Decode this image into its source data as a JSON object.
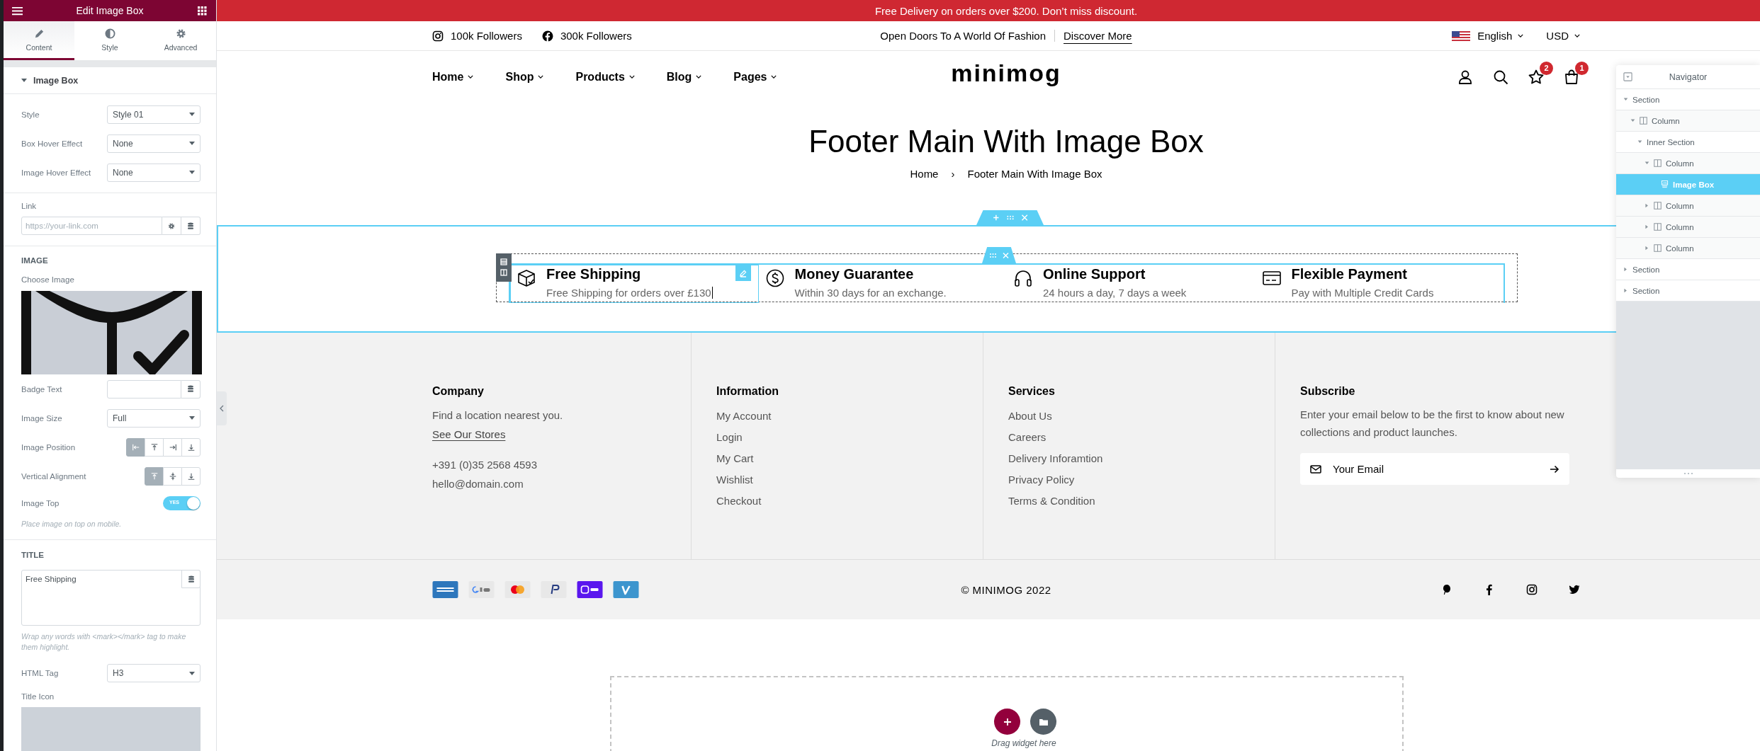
{
  "panel": {
    "title": "Edit Image Box",
    "tabs": [
      {
        "label": "Content",
        "kind": "pencil",
        "selected": true
      },
      {
        "label": "Style",
        "kind": "contrast",
        "selected": false
      },
      {
        "label": "Advanced",
        "kind": "gear",
        "selected": false
      }
    ],
    "section": {
      "title": "Image Box",
      "expanded": true
    },
    "effects": [
      {
        "label": "Style",
        "value": "Style 01"
      },
      {
        "label": "Box Hover Effect",
        "value": "None"
      },
      {
        "label": "Image Hover Effect",
        "value": "None"
      }
    ],
    "link": {
      "label": "Link",
      "placeholder": "https://your-link.com"
    },
    "image": {
      "heading": "IMAGE",
      "label": "Choose Image"
    },
    "image_controls": [
      {
        "kind": "text",
        "label": "Badge Text"
      },
      {
        "kind": "select",
        "label": "Image Size",
        "value": "Full"
      },
      {
        "kind": "choices",
        "label": "Image Position",
        "options": [
          {
            "kind": "left",
            "selected": true
          },
          {
            "kind": "top",
            "selected": false
          },
          {
            "kind": "right",
            "selected": false
          },
          {
            "kind": "bottom",
            "selected": false
          }
        ]
      },
      {
        "kind": "choices",
        "label": "Vertical Alignment",
        "options": [
          {
            "kind": "top",
            "selected": true
          },
          {
            "kind": "middle",
            "selected": false
          },
          {
            "kind": "bottom",
            "selected": false
          }
        ]
      },
      {
        "kind": "switch",
        "label": "Image Top",
        "on": true,
        "switch_text": "YES",
        "note": "Place image on top on mobile."
      }
    ],
    "title_group": {
      "heading": "TITLE",
      "value": "Free Shipping",
      "note": "Wrap any words with <mark></mark> tag to make them highlight.",
      "tag_label": "HTML Tag",
      "tag_value": "H3",
      "icon_label": "Title Icon"
    }
  },
  "announcement": "Free Delivery on orders over $200. Don’t miss discount.",
  "topbar": {
    "socials": [
      {
        "kind": "instagram",
        "label": "100k Followers"
      },
      {
        "kind": "facebook",
        "label": "300k Followers"
      }
    ],
    "promo": "Open Doors To A World Of Fashion",
    "promo_link": "Discover More",
    "language": "English",
    "currency": "USD"
  },
  "nav": {
    "menu": [
      "Home",
      "Shop",
      "Products",
      "Blog",
      "Pages"
    ],
    "logo": "minimog",
    "actions": [
      {
        "kind": "account"
      },
      {
        "kind": "search"
      },
      {
        "kind": "wishlist",
        "badge": "2"
      },
      {
        "kind": "cart",
        "badge": "1"
      }
    ]
  },
  "page_header": {
    "title": "Footer Main With Image Box",
    "breadcrumb": [
      "Home",
      "Footer Main With Image Box"
    ],
    "separator": "›"
  },
  "features": [
    {
      "kind": "box",
      "title": "Free Shipping",
      "text": "Free Shipping for orders over £130",
      "selected": true
    },
    {
      "kind": "dollar",
      "title": "Money Guarantee",
      "text": "Within 30 days for an exchange.",
      "selected": false
    },
    {
      "kind": "headphones",
      "title": "Online Support",
      "text": "24 hours a day, 7 days a week",
      "selected": false
    },
    {
      "kind": "card",
      "title": "Flexible Payment",
      "text": "Pay with Multiple Credit Cards",
      "selected": false
    }
  ],
  "footer": {
    "columns": [
      {
        "kind": "contact",
        "heading": "Company",
        "text": "Find a location nearest you.",
        "link": "See Our Stores",
        "phone": "+391 (0)35 2568 4593",
        "email": "hello@domain.com"
      },
      {
        "kind": "links",
        "heading": "Information",
        "links": [
          "My Account",
          "Login",
          "My Cart",
          "Wishlist",
          "Checkout"
        ]
      },
      {
        "kind": "links",
        "heading": "Services",
        "links": [
          "About Us",
          "Careers",
          "Delivery Inforamtion",
          "Privacy Policy",
          "Terms & Condition"
        ]
      },
      {
        "kind": "subscribe",
        "heading": "Subscribe",
        "text": "Enter your email below to be the first to know about new collections and product launches.",
        "placeholder": "Your Email"
      }
    ]
  },
  "footer_bottom": {
    "payments": [
      {
        "kind": "amex"
      },
      {
        "kind": "gpay"
      },
      {
        "kind": "mastercard"
      },
      {
        "kind": "paypal"
      },
      {
        "kind": "opay"
      },
      {
        "kind": "venmo"
      }
    ],
    "copyright": "© MINIMOG 2022",
    "socials": [
      {
        "kind": "pinterest"
      },
      {
        "kind": "facebook"
      },
      {
        "kind": "instagram"
      },
      {
        "kind": "twitter"
      }
    ]
  },
  "drop_zone": {
    "hint": "Drag widget here"
  },
  "navigator": {
    "title": "Navigator",
    "tree": [
      {
        "label": "Section",
        "expanded": true,
        "selected": false,
        "children": [
          {
            "label": "Column",
            "kind": "column",
            "expanded": true,
            "selected": false,
            "children": [
              {
                "label": "Inner Section",
                "expanded": true,
                "selected": false,
                "children": [
                  {
                    "label": "Column",
                    "kind": "column",
                    "expanded": true,
                    "selected": false,
                    "children": [
                      {
                        "label": "Image Box",
                        "kind": "widget",
                        "selected": true
                      }
                    ]
                  },
                  {
                    "label": "Column",
                    "kind": "column",
                    "expanded": false,
                    "selected": false
                  },
                  {
                    "label": "Column",
                    "kind": "column",
                    "expanded": false,
                    "selected": false
                  },
                  {
                    "label": "Column",
                    "kind": "column",
                    "expanded": false,
                    "selected": false
                  }
                ]
              }
            ]
          }
        ]
      },
      {
        "label": "Section",
        "expanded": false,
        "selected": false
      },
      {
        "label": "Section",
        "expanded": false,
        "selected": false
      }
    ]
  }
}
